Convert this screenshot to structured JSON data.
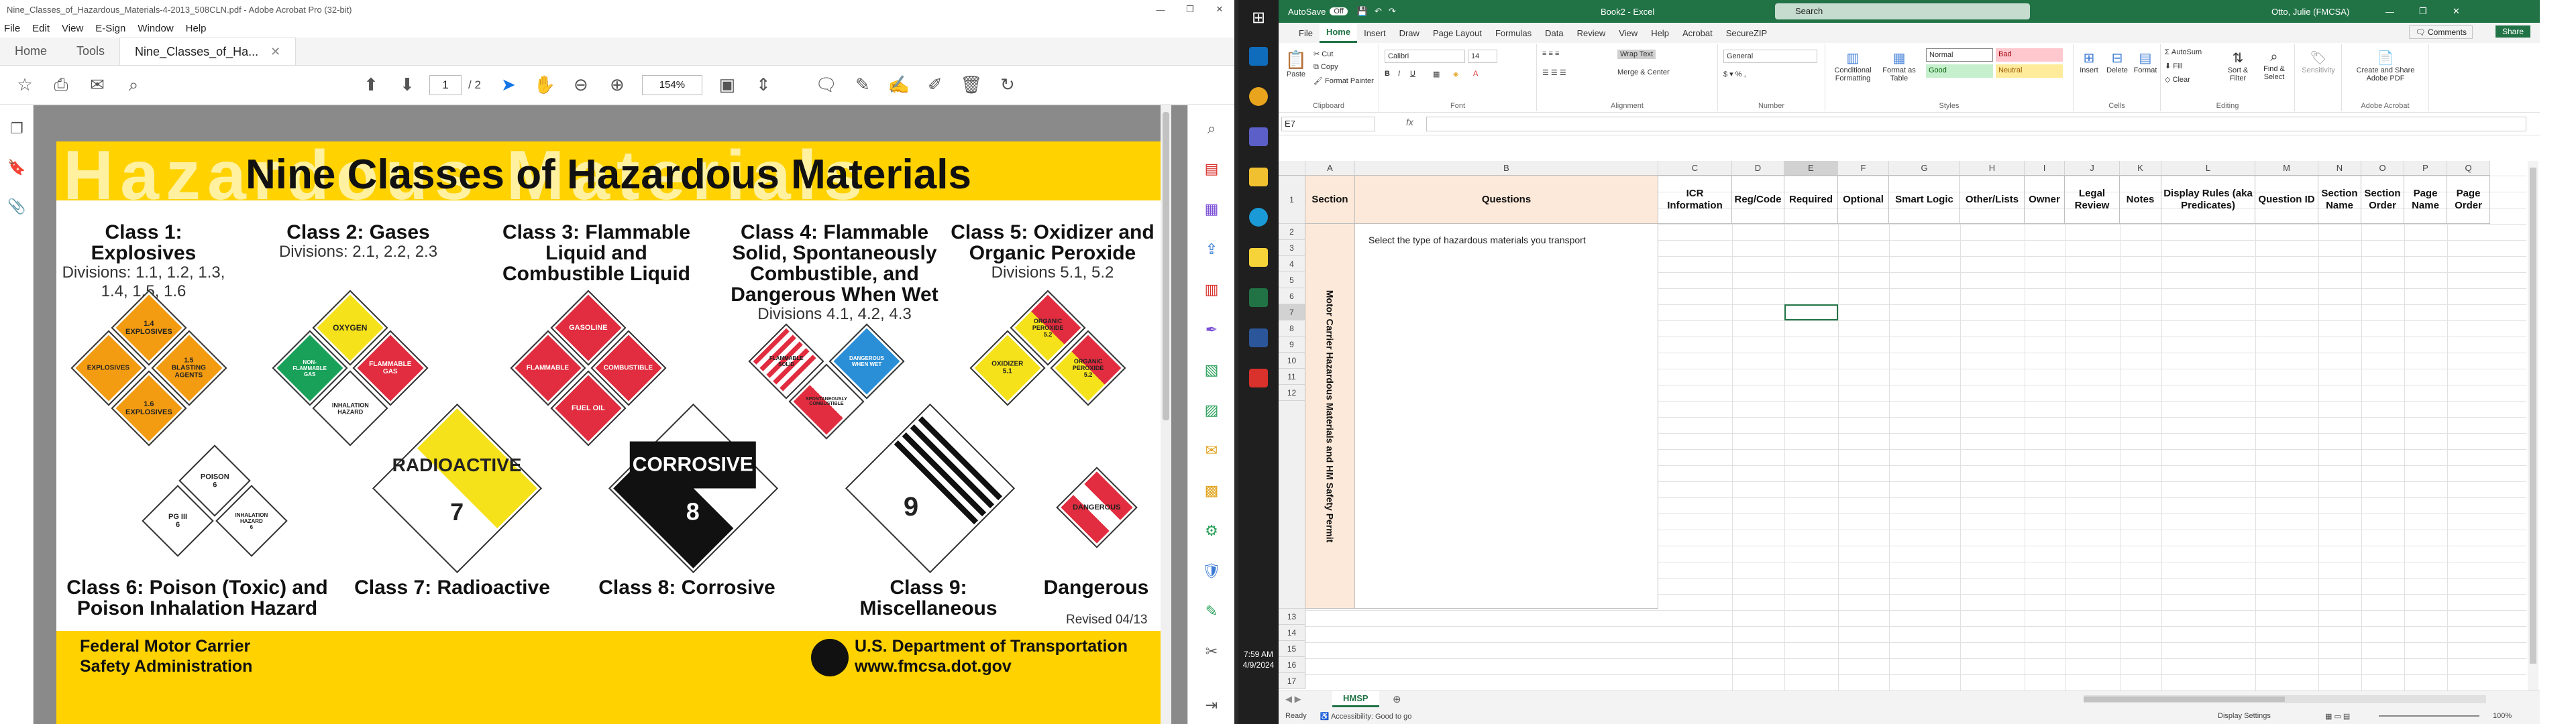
{
  "acrobat": {
    "window_title": "Nine_Classes_of_Hazardous_Materials-4-2013_508CLN.pdf - Adobe Acrobat Pro (32-bit)",
    "menu": [
      "File",
      "Edit",
      "View",
      "E-Sign",
      "Window",
      "Help"
    ],
    "tabs": {
      "home": "Home",
      "tools": "Tools",
      "doc": "Nine_Classes_of_Ha..."
    },
    "page_current": "1",
    "page_total": "/ 2",
    "zoom": "154%"
  },
  "pdf": {
    "watermark": "Hazardous Materials",
    "title": "Nine Classes of Hazardous Materials",
    "classes": [
      {
        "head": "Class 1: Explosives",
        "div": "Divisions: 1.1, 1.2, 1.3, 1.4, 1.5, 1.6"
      },
      {
        "head": "Class 2: Gases",
        "div": "Divisions: 2.1, 2.2, 2.3"
      },
      {
        "head": "Class 3: Flammable Liquid and Combustible Liquid",
        "div": ""
      },
      {
        "head": "Class 4: Flammable Solid, Spontaneously Combustible, and Dangerous When Wet",
        "div": "Divisions 4.1, 4.2, 4.3"
      },
      {
        "head": "Class 5: Oxidizer and Organic Peroxide",
        "div": "Divisions 5.1, 5.2"
      }
    ],
    "bottom_classes": [
      "Class 6: Poison (Toxic) and Poison Inhalation Hazard",
      "Class 7: Radioactive",
      "Class 8: Corrosive",
      "Class 9: Miscellaneous",
      "Dangerous"
    ],
    "placards": {
      "explosives_14": "1.4\nEXPLOSIVES",
      "explosives": "EXPLOSIVES",
      "blasting": "1.5\nBLASTING\nAGENTS",
      "explosives_16": "1.6\nEXPLOSIVES",
      "oxygen": "OXYGEN",
      "nonflam": "NON-FLAMMABLE\nGAS",
      "flamgas": "FLAMMABLE\nGAS",
      "inhal": "INHALATION\nHAZARD",
      "gasoline": "GASOLINE",
      "flammable": "FLAMMABLE",
      "combustible": "COMBUSTIBLE",
      "fueloil": "FUEL OIL",
      "flamsolid": "FLAMMABLE\nSOLID",
      "dangerwet": "DANGEROUS\nWHEN WET",
      "spontcomb": "SPONTANEOUSLY\nCOMBUSTIBLE",
      "organic": "ORGANIC\nPEROXIDE\n5.2",
      "oxidizer": "OXIDIZER\n5.1",
      "organic2": "ORGANIC\nPEROXIDE\n5.2",
      "poison": "POISON\n6",
      "pg": "PG III\n6",
      "inhal6": "INHALATION\nHAZARD\n6",
      "radioactive": "RADIOACTIVE",
      "seven": "7",
      "corrosive": "CORROSIVE",
      "eight": "8",
      "nine": "9",
      "dangerous": "DANGEROUS"
    },
    "revised": "Revised 04/13",
    "footer_left": "Federal Motor Carrier\nSafety Administration",
    "footer_right": "U.S. Department of Transportation\nwww.fmcsa.dot.gov"
  },
  "excel": {
    "autosave": "AutoSave",
    "autosave_state": "Off",
    "title": "Book2 - Excel",
    "search": "Search",
    "user": "Otto, Julie (FMCSA)",
    "tabs": [
      "File",
      "Home",
      "Insert",
      "Draw",
      "Page Layout",
      "Formulas",
      "Data",
      "Review",
      "View",
      "Help",
      "Acrobat",
      "SecureZIP"
    ],
    "comments": "Comments",
    "share": "Share",
    "ribbon": {
      "paste": "Paste",
      "cut": "Cut",
      "copy": "Copy",
      "format_painter": "Format Painter",
      "clipboard": "Clipboard",
      "font_name": "Calibri",
      "font_size": "14",
      "font": "Font",
      "wrap": "Wrap Text",
      "merge": "Merge & Center",
      "alignment": "Alignment",
      "number_format": "General",
      "number": "Number",
      "cond": "Conditional Formatting",
      "fmt_table": "Format as Table",
      "styles": "Styles",
      "style_normal": "Normal",
      "style_bad": "Bad",
      "style_good": "Good",
      "style_neutral": "Neutral",
      "insert": "Insert",
      "delete": "Delete",
      "format": "Format",
      "cells": "Cells",
      "autosum": "AutoSum",
      "fill": "Fill",
      "clear": "Clear",
      "sort": "Sort & Filter",
      "find": "Find & Select",
      "editing": "Editing",
      "sensitivity": "Sensitivity",
      "create_pdf": "Create and Share Adobe PDF",
      "adobe": "Adobe Acrobat"
    },
    "namebox": "E7",
    "columns": [
      "A",
      "B",
      "C",
      "D",
      "E",
      "F",
      "G",
      "H",
      "I",
      "J",
      "K",
      "L",
      "M",
      "N",
      "O",
      "P",
      "Q"
    ],
    "headers": [
      "Section",
      "Questions",
      "ICR Information",
      "Reg/Code",
      "Required",
      "Optional",
      "Smart Logic",
      "Other/Lists",
      "Owner",
      "Legal Review",
      "Notes",
      "Display Rules (aka Predicates)",
      "Question ID",
      "Section Name",
      "Section Order",
      "Page Name",
      "Page Order"
    ],
    "section_label": "Motor Carrier Hazardous Materials and HM Safety Permit",
    "question_b2": "Select the type of hazardous materials you transport",
    "rows": [
      "1",
      "2",
      "3",
      "4",
      "5",
      "6",
      "7",
      "8",
      "9",
      "10",
      "11",
      "12",
      "13",
      "14",
      "15",
      "16",
      "17"
    ],
    "sheet_tab": "HMSP",
    "status_ready": "Ready",
    "status_access": "Accessibility: Good to go",
    "status_display": "Display Settings",
    "zoom": "100%"
  },
  "taskbar": {
    "time": "7:59 AM",
    "date": "4/9/2024"
  }
}
